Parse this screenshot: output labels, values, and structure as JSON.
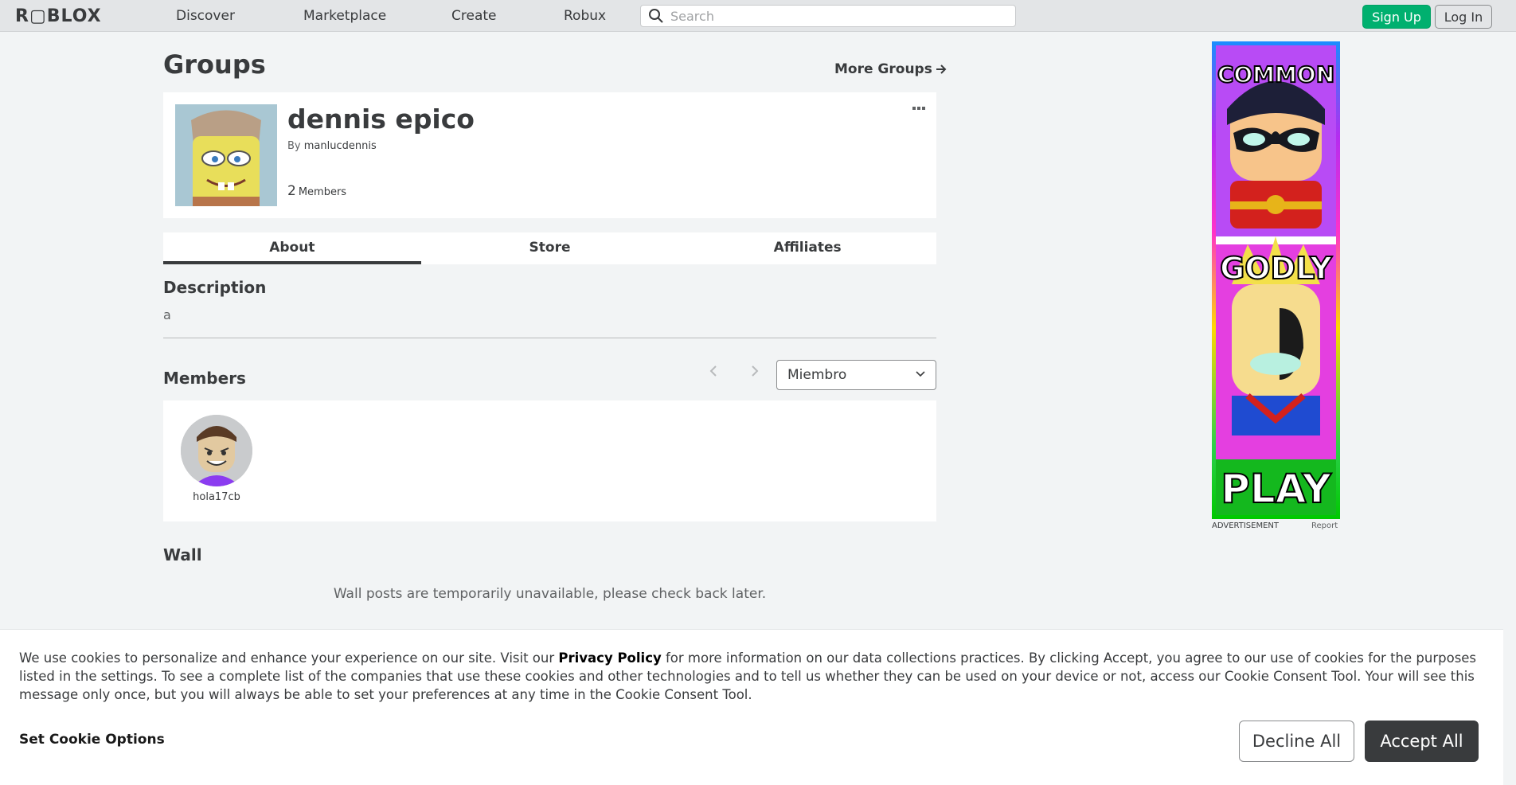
{
  "nav": {
    "logo": "R▢BLOX",
    "links": [
      "Discover",
      "Marketplace",
      "Create",
      "Robux"
    ],
    "search_placeholder": "Search",
    "signup_label": "Sign Up",
    "login_label": "Log In"
  },
  "page": {
    "title": "Groups",
    "more_groups": "More Groups"
  },
  "group": {
    "name": "dennis epico",
    "by_label": "By",
    "owner": "manlucdennis",
    "member_count": "2",
    "members_label": "Members",
    "more_icon": "more-dots-icon"
  },
  "tabs": [
    "About",
    "Store",
    "Affiliates"
  ],
  "description": {
    "heading": "Description",
    "text": "a"
  },
  "members": {
    "heading": "Members",
    "role_selected": "Miembro",
    "list": [
      {
        "name": "hola17cb"
      }
    ]
  },
  "wall": {
    "heading": "Wall",
    "message": "Wall posts are temporarily unavailable, please check back later."
  },
  "ad": {
    "texts": [
      "COMMON",
      "GODLY",
      "PLAY"
    ],
    "label": "ADVERTISEMENT",
    "report": "Report"
  },
  "cookie": {
    "text_before": "We use cookies to personalize and enhance your experience on our site. Visit our ",
    "privacy_link": "Privacy Policy",
    "text_after": " for more information on our data collections practices. By clicking Accept, you agree to our use of cookies for the purposes listed in the settings. To see a complete list of the companies that use these cookies and other technologies and to tell us whether they can be used on your device or not, access our Cookie Consent Tool. Your will see this message only once, but you will always be able to set your preferences at any time in the Cookie Consent Tool.",
    "set_options": "Set Cookie Options",
    "decline": "Decline All",
    "accept": "Accept All"
  },
  "colors": {
    "signup_green": "#00b06f",
    "page_bg": "#f2f4f5",
    "accept_dark": "#393b3d"
  }
}
